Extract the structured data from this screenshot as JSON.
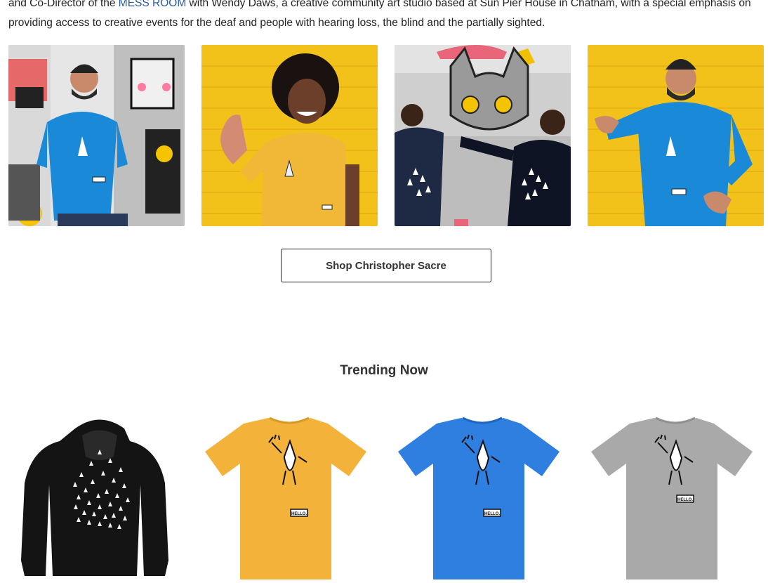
{
  "intro": {
    "line1_pre": "and Co-Director of the ",
    "line1_link": "MESS ROOM",
    "line1_post": " with Wendy Daws, a creative community art studio based at Sun Pier House in Chatham, with a special emphasis on",
    "line2": "providing access to creative events for the deaf and people with hearing loss, the blind and the partially sighted."
  },
  "gallery": {
    "photos": [
      {
        "name": "man-blue-tee-graffiti",
        "bg": "#3a3a3a",
        "shirt": "#1a8ad8"
      },
      {
        "name": "person-yellow-tee-yellow-wall",
        "bg": "#f2c21a",
        "shirt": "#f0b836"
      },
      {
        "name": "two-kids-navy-hoodies-cat-mural",
        "bg": "#b8b8b8",
        "shirt": "#1e2a44"
      },
      {
        "name": "man-blue-tee-yellow-wall",
        "bg": "#f2c21a",
        "shirt": "#1a8ad8"
      }
    ]
  },
  "shop_button": {
    "label": "Shop Christopher Sacre"
  },
  "trending": {
    "title": "Trending Now",
    "products": [
      {
        "name": "black-hoodie",
        "type": "hoodie",
        "color": "#141414",
        "badge": ""
      },
      {
        "name": "yellow-tee",
        "type": "tee",
        "color": "#f3b33a",
        "badge": "HELLO."
      },
      {
        "name": "blue-tee",
        "type": "tee",
        "color": "#2f7fe0",
        "badge": "HELLO."
      },
      {
        "name": "grey-tee",
        "type": "tee",
        "color": "#a9a9a9",
        "badge": "HELLO."
      }
    ]
  }
}
